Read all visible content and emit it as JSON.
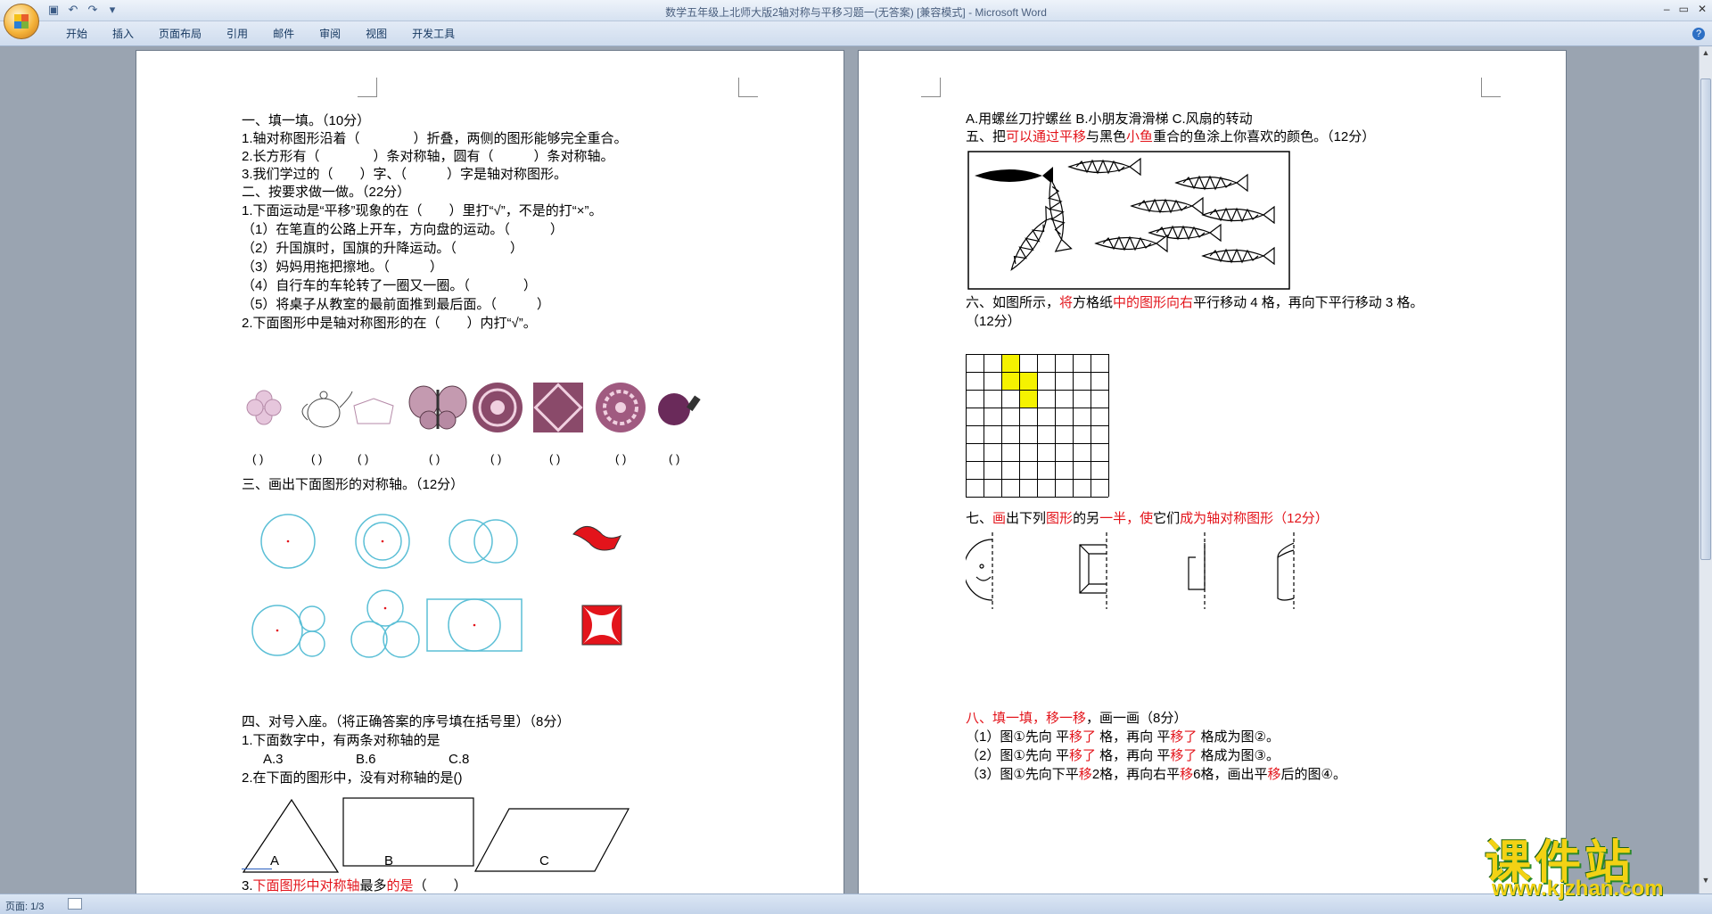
{
  "window": {
    "title": "数学五年级上北师大版2轴对称与平移习题一(无答案) [兼容模式] - Microsoft Word"
  },
  "ribbon": {
    "tabs": [
      "开始",
      "插入",
      "页面布局",
      "引用",
      "邮件",
      "审阅",
      "视图",
      "开发工具"
    ]
  },
  "status": {
    "page": "页面: 1/3"
  },
  "page1": {
    "s1": "一、填一填。（10分）",
    "q1_1": "1.轴对称图形沿着（　　　　）折叠，两侧的图形能够完全重合。",
    "q1_2": "2.长方形有（　　　　）条对称轴，圆有（　　　）条对称轴。",
    "q1_3": "3.我们学过的（　　）字、（　　　）字是轴对称图形。",
    "s2": "二、按要求做一做。（22分）",
    "q2_1": "1.下面运动是“平移”现象的在（　　）里打“√”，不是的打“×”。",
    "q2_1a": "（1）在笔直的公路上开车，方向盘的运动。（　　　）",
    "q2_1b": "（2）升国旗时，国旗的升降运动。（　　　　）",
    "q2_1c": "（3）妈妈用拖把擦地。（　　　）",
    "q2_1d": "（4）自行车的车轮转了一圈又一圈。（　　　　）",
    "q2_1e": "（5）将桌子从教室的最前面推到最后面。（　　　）",
    "q2_2": "2.下面图形中是轴对称图形的在（　　）内打“√”。",
    "paren": "(   )",
    "s3": "三、画出下面图形的对称轴。（12分）",
    "s4": "四、对号入座。（将正确答案的序号填在括号里）（8分）",
    "q4_1": "1.下面数字中，有两条对称轴的是",
    "q4_1opts": [
      "A.3",
      "B.6",
      "C.8"
    ],
    "q4_2": "2.在下面的图形中，没有对称轴的是()",
    "q4_2labels": [
      "A",
      "B",
      "C"
    ],
    "q4_3a": "3.",
    "q4_3b": "下面图形中对称轴",
    "q4_3c": "最多",
    "q4_3d": "的是",
    "q4_3e": "（　　）"
  },
  "page2": {
    "top": "A.用螺丝刀拧螺丝 B.小朋友滑滑梯 C.风扇的转动",
    "s5a": "五、把",
    "s5b": "可以通过平移",
    "s5c": "与黑色",
    "s5d": "小鱼",
    "s5e": "重合的鱼涂上你喜欢的颜色。（12分）",
    "s6a": "六、如图所示，",
    "s6b": "将",
    "s6c": "方格纸",
    "s6d": "中的图形向右",
    "s6e": "平行移动 4 格，再向下平行移动 3 格。",
    "s6f": "（12分）",
    "s7a": "七、",
    "s7b": "画",
    "s7c": "出下列",
    "s7d": "图形",
    "s7e": "的另",
    "s7f": "一半，",
    "s7g": "使",
    "s7h": "它们",
    "s7i": "成为轴对称图形（12分）",
    "s8a": "八、填一填，移一移",
    "s8b": "，画一画（8分）",
    "q8_1a": "（1）图①先向  平",
    "q8_1b": "移了",
    "q8_1c": "  格，再向  平",
    "q8_1d": "移了",
    "q8_1e": "  格成为图②。",
    "q8_2a": "（2）图①先向  平",
    "q8_2b": "移了",
    "q8_2c": "  格，再向  平",
    "q8_2d": "移了",
    "q8_2e": "  格成为图③。",
    "q8_3a": "（3）图①先向下平",
    "q8_3b": "移",
    "q8_3c": "2格，再向右平",
    "q8_3d": "移",
    "q8_3e": "6格，画出平",
    "q8_3f": "移",
    "q8_3g": "后的图④。"
  },
  "watermark": {
    "cn": "课件站",
    "url": "www.kjzhan.com"
  },
  "colors": {
    "accent_red": "#e3141b",
    "highlight_yellow": "#f5f200",
    "circle_blue": "#5bbfd6"
  },
  "paragraph_mark": "↵"
}
